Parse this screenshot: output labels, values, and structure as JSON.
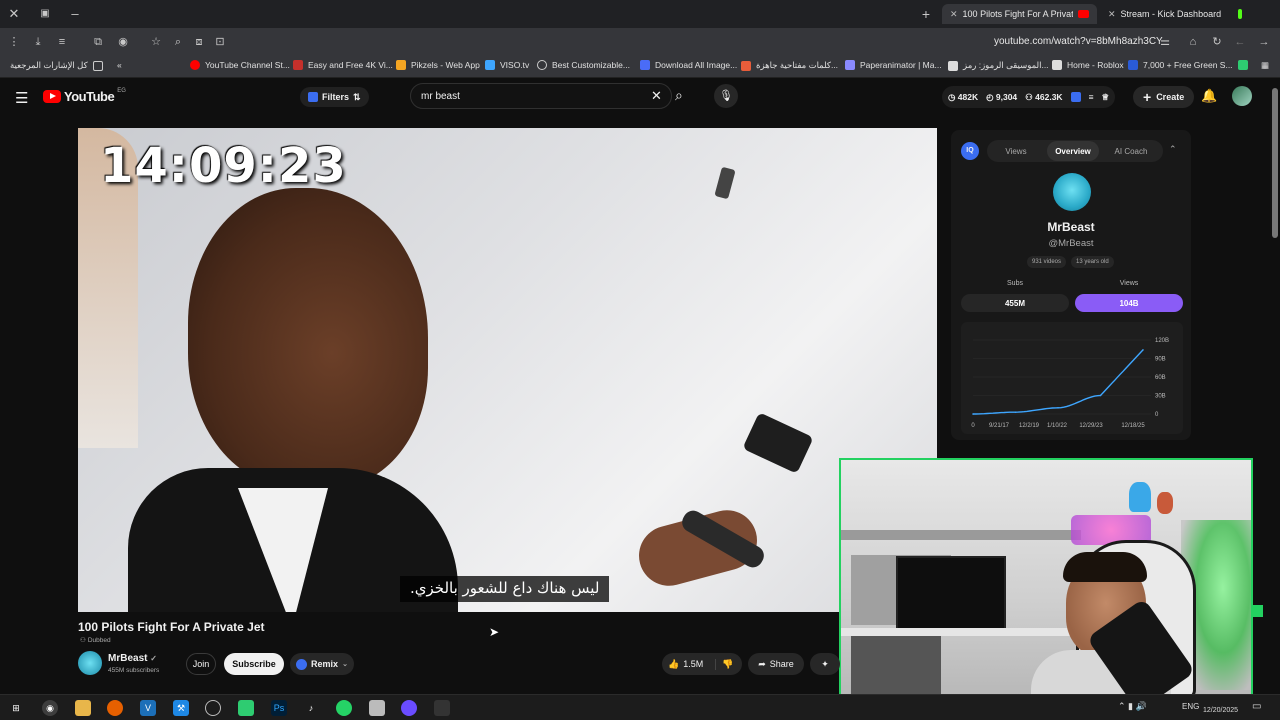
{
  "browser": {
    "tabs": [
      {
        "label": "100 Pilots Fight For A Private Jet",
        "active": true
      },
      {
        "label": "Stream - Kick Dashboard",
        "active": false
      }
    ],
    "url": "youtube.com/watch?v=8bMh8azh3CY",
    "bookmarks": [
      "كل الإشارات المرجعية",
      "YouTube Channel St...",
      "Easy and Free 4K Vi...",
      "Pikzels - Web App",
      "VISO.tv",
      "Best Customizable...",
      "Download All Image...",
      "كلمات مفتاحية جاهزة...",
      "Paperanimator | Ma...",
      "الموسيقى الرموز: رمز...",
      "Home - Roblox",
      "7,000 + Free Green S..."
    ]
  },
  "youtube": {
    "logo": "YouTube",
    "country": "EG",
    "filters_label": "Filters",
    "search_query": "mr beast",
    "stats": [
      "482K",
      "9,304",
      "462.3K"
    ],
    "create_label": "Create"
  },
  "video": {
    "timer": "14:09:23",
    "subtitle": "ليس هناك داع للشعور بالخزي.",
    "title": "100 Pilots Fight For A Private Jet",
    "dubbed": "Dubbed",
    "channel": "MrBeast",
    "subscribers": "455M subscribers",
    "join_label": "Join",
    "subscribe_label": "Subscribe",
    "remix_label": "Remix",
    "likes": "1.5M",
    "share_label": "Share"
  },
  "panel": {
    "tabs": [
      "Views",
      "Overview",
      "AI Coach"
    ],
    "channel_name": "MrBeast",
    "handle": "@MrBeast",
    "meta": [
      "931 videos",
      "13 years old"
    ],
    "subs_label": "Subs",
    "subs_value": "455M",
    "views_label": "Views",
    "views_value": "104B"
  },
  "chart_data": {
    "type": "line",
    "x": [
      "9/21/17",
      "12/2/19",
      "1/10/22",
      "12/29/23",
      "12/18/25"
    ],
    "series": [
      {
        "values": [
          0,
          3,
          10,
          30,
          104
        ]
      }
    ],
    "y_ticks": [
      "120B",
      "90B",
      "60B",
      "30B",
      "0"
    ],
    "x_ticks": [
      "0",
      "9/21/17",
      "12/2/19",
      "1/10/22",
      "12/29/23",
      "12/18/25"
    ],
    "ylim": [
      0,
      120
    ],
    "color": "#3ea6ff"
  },
  "taskbar": {
    "lang": "ENG",
    "date": "12/20/2025"
  }
}
